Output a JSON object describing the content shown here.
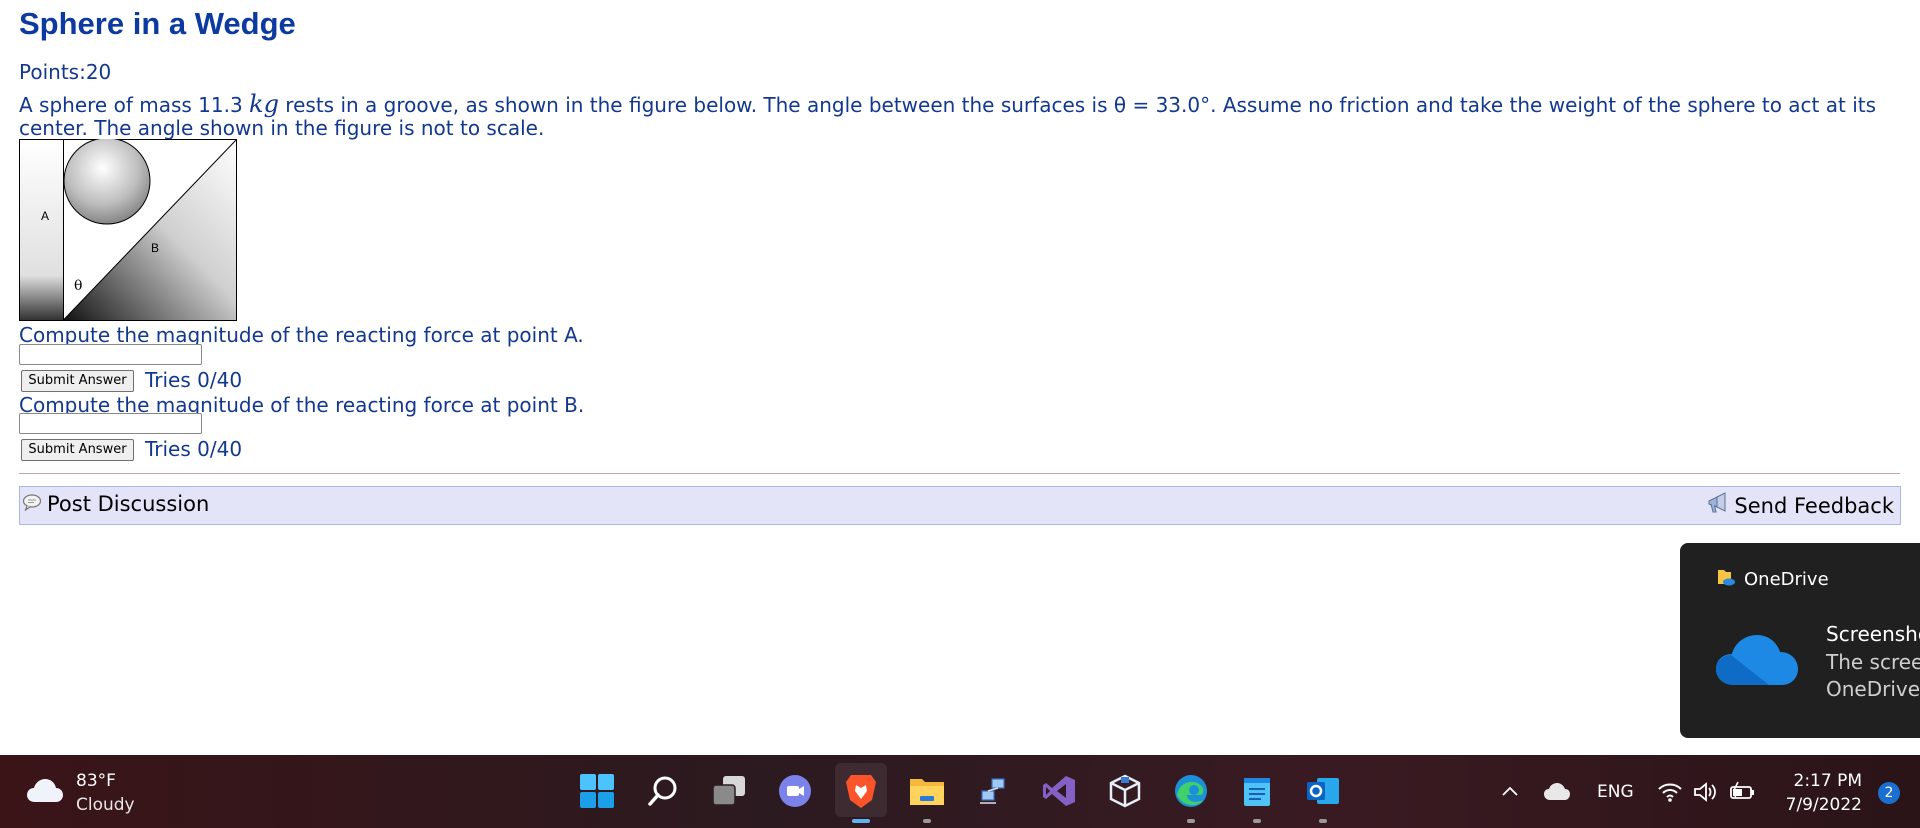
{
  "problem": {
    "title": "Sphere in a Wedge",
    "points": "Points:20",
    "intro_before_mass": "A sphere of mass 11.3 ",
    "mass_unit": "kg",
    "intro_after_mass": " rests in a groove, as shown in the figure below. The angle between the surfaces is θ = 33.0°. Assume no friction and take the weight of the sphere to act at its center. The angle shown in the figure is not to scale.",
    "figure": {
      "label_a": "A",
      "label_b": "B",
      "label_theta": "θ"
    },
    "questions": [
      {
        "prompt": "Compute the magnitude of the reacting force at point A.",
        "input_value": "",
        "submit_label": "Submit Answer",
        "tries": "Tries 0/40"
      },
      {
        "prompt": "Compute the magnitude of the reacting force at point B.",
        "input_value": "",
        "submit_label": "Submit Answer",
        "tries": "Tries 0/40"
      }
    ],
    "post_discussion_label": "Post Discussion",
    "send_feedback_label": "Send Feedback"
  },
  "toast": {
    "app_name": "OneDrive",
    "title": "Screensho",
    "line1": "The screen",
    "line2": "OneDrive."
  },
  "taskbar": {
    "weather_temp": "83°F",
    "weather_cond": "Cloudy",
    "apps": [
      "start-icon",
      "search-icon",
      "task-view-icon",
      "chat-icon",
      "brave-browser-icon",
      "file-explorer-icon",
      "network-app-icon",
      "visual-studio-icon",
      "virtualbox-icon",
      "edge-browser-icon",
      "notepad-icon",
      "outlook-icon"
    ],
    "tray_lang": "ENG",
    "time": "2:17 PM",
    "date": "7/9/2022",
    "notification_count": "2"
  },
  "colors": {
    "title": "#0d3aa0",
    "text": "#13388f",
    "discussion_bar": "#e4e4f8",
    "taskbar": "#2b1a20",
    "accent": "#5fb2f2"
  }
}
